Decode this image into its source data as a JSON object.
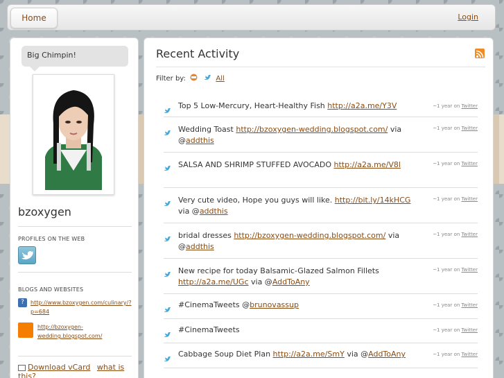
{
  "nav": {
    "home": "Home",
    "login": "Login"
  },
  "profile": {
    "status": "Big Chimpin!",
    "username": "bzoxygen",
    "profiles_heading": "PROFILES ON THE WEB",
    "blogs_heading": "BLOGS AND WEBSITES",
    "sites": [
      {
        "url": "http://www.bzoxygen.com/culinary/?p=684"
      },
      {
        "url": "http://bzoxygen-wedding.blogspot.com/"
      }
    ],
    "vcard": "Download vCard",
    "what": "what is this?"
  },
  "activity": {
    "title": "Recent Activity",
    "filter_label": "Filter by:",
    "filter_all": "All",
    "items": [
      {
        "text": "Top 5 Low-Mercury, Heart-Healthy Fish ",
        "link": "http://a2a.me/Y3V",
        "via": "",
        "mention": "",
        "time": "~1 year on",
        "source": "Twitter"
      },
      {
        "text": "Wedding Toast ",
        "link": "http://bzoxygen-wedding.blogspot.com/",
        "via": " via @",
        "mention": "addthis",
        "time": "~1 year on",
        "source": "Twitter"
      },
      {
        "text": "SALSA AND SHRIMP STUFFED AVOCADO ",
        "link": "http://a2a.me/V8l",
        "via": "",
        "mention": "",
        "time": "~1 year on",
        "source": "Twitter"
      },
      {
        "text": "Very cute video, Hope you guys will like. ",
        "link": "http://bit.ly/14kHCG",
        "via": " via @",
        "mention": "addthis",
        "time": "~1 year on",
        "source": "Twitter"
      },
      {
        "text": "bridal dresses ",
        "link": "http://bzoxygen-wedding.blogspot.com/",
        "via": " via @",
        "mention": "addthis",
        "time": "~1 year on",
        "source": "Twitter"
      },
      {
        "text": "New recipe for today Balsamic-Glazed Salmon Fillets ",
        "link": "http://a2a.me/UGc",
        "via": " via @",
        "mention": "AddToAny",
        "time": "~1 year on",
        "source": "Twitter"
      },
      {
        "text": "#CinemaTweets @",
        "link": "brunovassup",
        "via": "",
        "mention": "",
        "time": "~1 year on",
        "source": "Twitter"
      },
      {
        "text": "#CinemaTweets",
        "link": "",
        "via": "",
        "mention": "",
        "time": "~1 year on",
        "source": "Twitter"
      },
      {
        "text": "Cabbage Soup Diet Plan ",
        "link": "http://a2a.me/SmY",
        "via": " via @",
        "mention": "AddToAny",
        "time": "~1 year on",
        "source": "Twitter"
      }
    ]
  },
  "colors": {
    "link": "#8a4b12",
    "twitter": "#4aa8d8",
    "rss": "#f08a24",
    "blogger": "#f57d00"
  }
}
